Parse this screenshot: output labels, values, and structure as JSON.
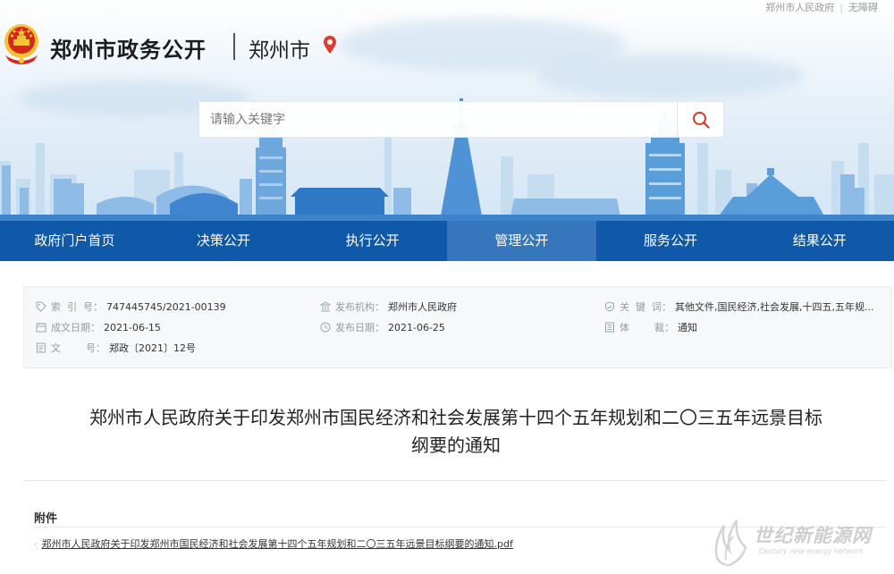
{
  "top_links": {
    "gov_link": "郑州市人民政府",
    "separator": "|",
    "accessibility": "无障碍"
  },
  "header": {
    "site_title": "郑州市政务公开",
    "city": "郑州市"
  },
  "search": {
    "placeholder": "请输入关键字"
  },
  "nav": {
    "items": [
      {
        "label": "政府门户首页"
      },
      {
        "label": "决策公开"
      },
      {
        "label": "执行公开"
      },
      {
        "label": "管理公开"
      },
      {
        "label": "服务公开"
      },
      {
        "label": "结果公开"
      }
    ],
    "active_index": 3
  },
  "meta": {
    "index_label": "索  引  号：",
    "index_value": "747445745/2021-00139",
    "publisher_label": "发布机构：",
    "publisher_value": "郑州市人民政府",
    "keywords_label": "关  键  词：",
    "keywords_value": "其他文件,国民经济,社会发展,十四五,五年规...",
    "created_label": "成文日期：",
    "created_value": "2021-06-15",
    "published_label": "发布日期：",
    "published_value": "2021-06-25",
    "genre_label": "体        裁：",
    "genre_value": "通知",
    "docno_label": "文        号：",
    "docno_value": "郑政〔2021〕12号"
  },
  "article": {
    "title_line1": "郑州市人民政府关于印发郑州市国民经济和社会发展第十四个五年规划和二〇三五年远景目标",
    "title_line2": "纲要的通知",
    "attachment_label": "附件",
    "attachment_bullet": "·",
    "attachment_link": "郑州市人民政府关于印发郑州市国民经济和社会发展第十四个五年规划和二〇三五年远景目标纲要的通知.pdf"
  },
  "watermark": {
    "text": "世纪新能源网",
    "subtext": "Century new energy network"
  },
  "colors": {
    "nav_bg": "#1058a8",
    "nav_active": "#3576bd",
    "emblem_red": "#d7261c",
    "emblem_gold": "#f3c338",
    "location_red": "#e23a2e",
    "search_icon": "#d23b2c"
  }
}
